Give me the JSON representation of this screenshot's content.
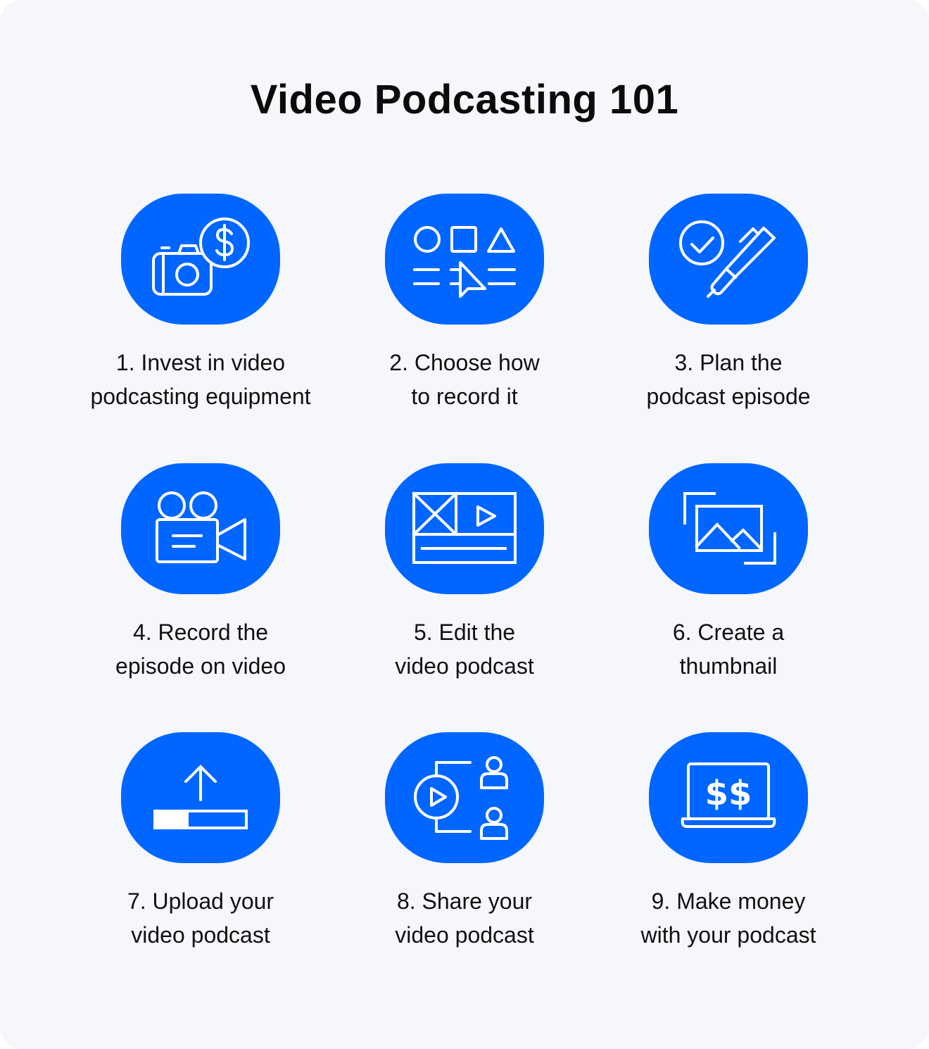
{
  "title": "Video Podcasting 101",
  "accent_color": "#0066ff",
  "steps": [
    {
      "icon": "camera-dollar-icon",
      "line1": "1. Invest in video",
      "line2": "podcasting equipment"
    },
    {
      "icon": "shapes-cursor-icon",
      "line1": "2. Choose how",
      "line2": "to record it"
    },
    {
      "icon": "check-pen-icon",
      "line1": "3. Plan the",
      "line2": "podcast episode"
    },
    {
      "icon": "video-camera-icon",
      "line1": "4. Record the",
      "line2": "episode on video"
    },
    {
      "icon": "video-editor-icon",
      "line1": "5. Edit the",
      "line2": "video podcast"
    },
    {
      "icon": "image-thumbnail-icon",
      "line1": "6. Create a",
      "line2": "thumbnail"
    },
    {
      "icon": "upload-progress-icon",
      "line1": "7. Upload your",
      "line2": "video podcast"
    },
    {
      "icon": "share-audience-icon",
      "line1": "8. Share your",
      "line2": "video podcast"
    },
    {
      "icon": "laptop-money-icon",
      "line1": "9. Make money",
      "line2": "with your podcast"
    }
  ]
}
